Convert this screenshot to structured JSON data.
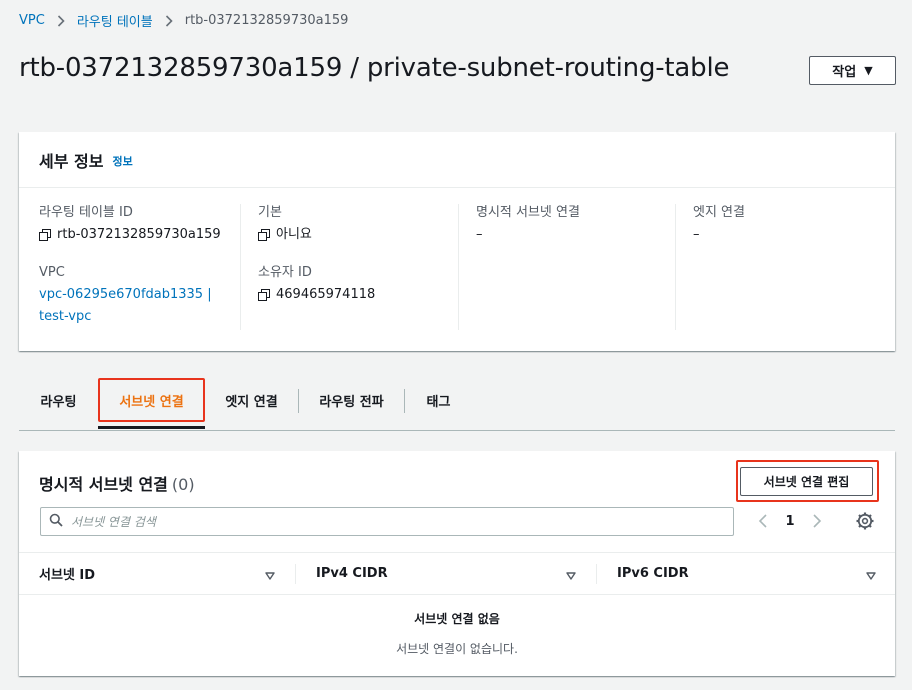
{
  "breadcrumb": {
    "items": [
      "VPC",
      "라우팅 테이블",
      "rtb-0372132859730a159"
    ]
  },
  "page": {
    "title": "rtb-0372132859730a159 / private-subnet-routing-table",
    "actions_label": "작업"
  },
  "details": {
    "title": "세부 정보",
    "info_label": "정보",
    "route_table_id_label": "라우팅 테이블 ID",
    "route_table_id_value": "rtb-0372132859730a159",
    "vpc_label": "VPC",
    "vpc_value_line1": "vpc-06295e670fdab1335 |",
    "vpc_value_line2": "test-vpc",
    "main_label": "기본",
    "main_value": "아니요",
    "owner_id_label": "소유자 ID",
    "owner_id_value": "469465974118",
    "explicit_subnet_label": "명시적 서브넷 연결",
    "explicit_subnet_value": "–",
    "edge_label": "엣지 연결",
    "edge_value": "–"
  },
  "tabs": {
    "items": [
      "라우팅",
      "서브넷 연결",
      "엣지 연결",
      "라우팅 전파",
      "태그"
    ],
    "active_index": 1
  },
  "subnets": {
    "title": "명시적 서브넷 연결",
    "count": "(0)",
    "edit_button": "서브넷 연결 편집",
    "search_placeholder": "서브넷 연결 검색",
    "page_number": "1",
    "columns": [
      "서브넷 ID",
      "IPv4 CIDR",
      "IPv6 CIDR"
    ],
    "empty_title": "서브넷 연결 없음",
    "empty_description": "서브넷 연결이 없습니다."
  },
  "colors": {
    "link": "#0073bb",
    "active_tab": "#ec7211",
    "highlight": "#e8341c"
  },
  "icons": [
    "chevron-right-icon",
    "caret-down-icon",
    "copy-icon",
    "search-icon",
    "chevron-left-icon",
    "settings-gear-icon",
    "sort-caret-icon"
  ]
}
